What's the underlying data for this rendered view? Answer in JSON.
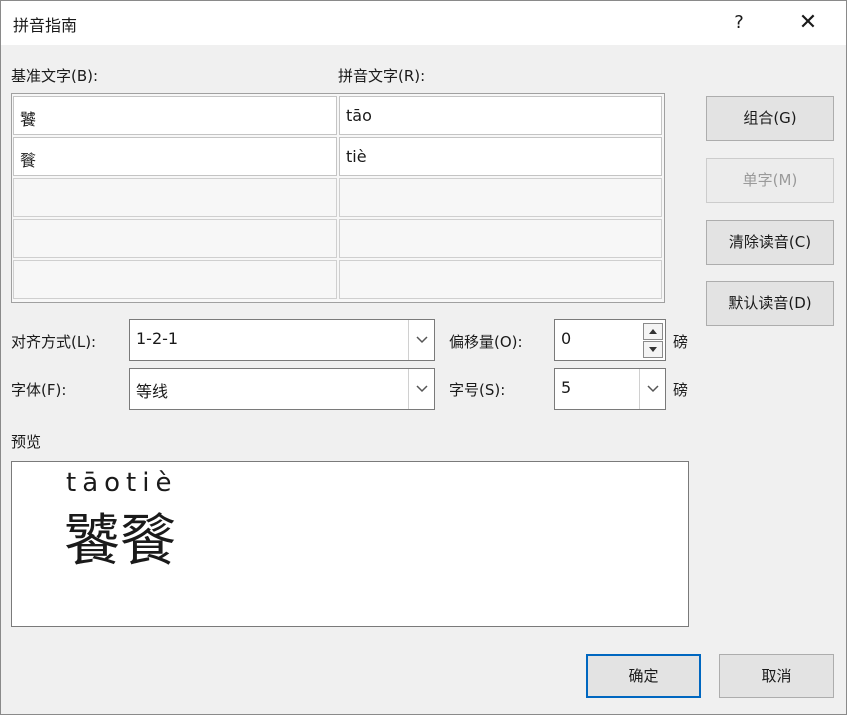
{
  "window": {
    "title": "拼音指南",
    "help_icon": "question-icon",
    "close_icon": "close-icon",
    "help_glyph": "?",
    "close_glyph": "✕"
  },
  "labels": {
    "base_text": "基准文字(B):",
    "pinyin_text": "拼音文字(R):",
    "alignment": "对齐方式(L):",
    "offset": "偏移量(O):",
    "font": "字体(F):",
    "font_size": "字号(S):",
    "unit_offset": "磅",
    "unit_size": "磅",
    "preview": "预览"
  },
  "rows": [
    {
      "base": "饕",
      "pinyin": "tāo"
    },
    {
      "base": "餮",
      "pinyin": "tiè"
    },
    {
      "base": "",
      "pinyin": ""
    },
    {
      "base": "",
      "pinyin": ""
    },
    {
      "base": "",
      "pinyin": ""
    }
  ],
  "buttons": {
    "combine": "组合(G)",
    "single": "单字(M)",
    "clear": "清除读音(C)",
    "default_reading": "默认读音(D)",
    "ok": "确定",
    "cancel": "取消"
  },
  "fields": {
    "alignment": "1-2-1",
    "offset": "0",
    "font": "等线",
    "font_size": "5"
  },
  "preview": {
    "pinyin": "tāotiè",
    "base": "饕餮"
  }
}
